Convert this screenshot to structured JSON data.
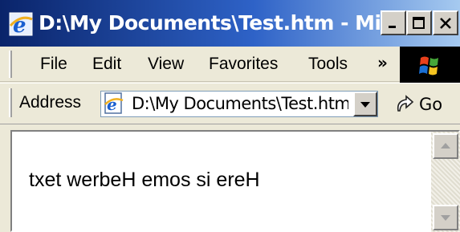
{
  "window": {
    "title": "D:\\My Documents\\Test.htm - Micr...",
    "app_icon": "ie-icon",
    "buttons": [
      "minimize-icon",
      "maximize-icon",
      "close-icon"
    ]
  },
  "menu": {
    "items": [
      "File",
      "Edit",
      "View",
      "Favorites",
      "Tools"
    ],
    "overflow": "»"
  },
  "address": {
    "label": "Address",
    "value": "D:\\My Documents\\Test.htm",
    "go_label": "Go"
  },
  "content": {
    "text": "txet werbeH emos si ereH"
  },
  "colors": {
    "titlebar_start": "#0a246a",
    "titlebar_end": "#a6caf0",
    "chrome": "#ece9d8"
  }
}
